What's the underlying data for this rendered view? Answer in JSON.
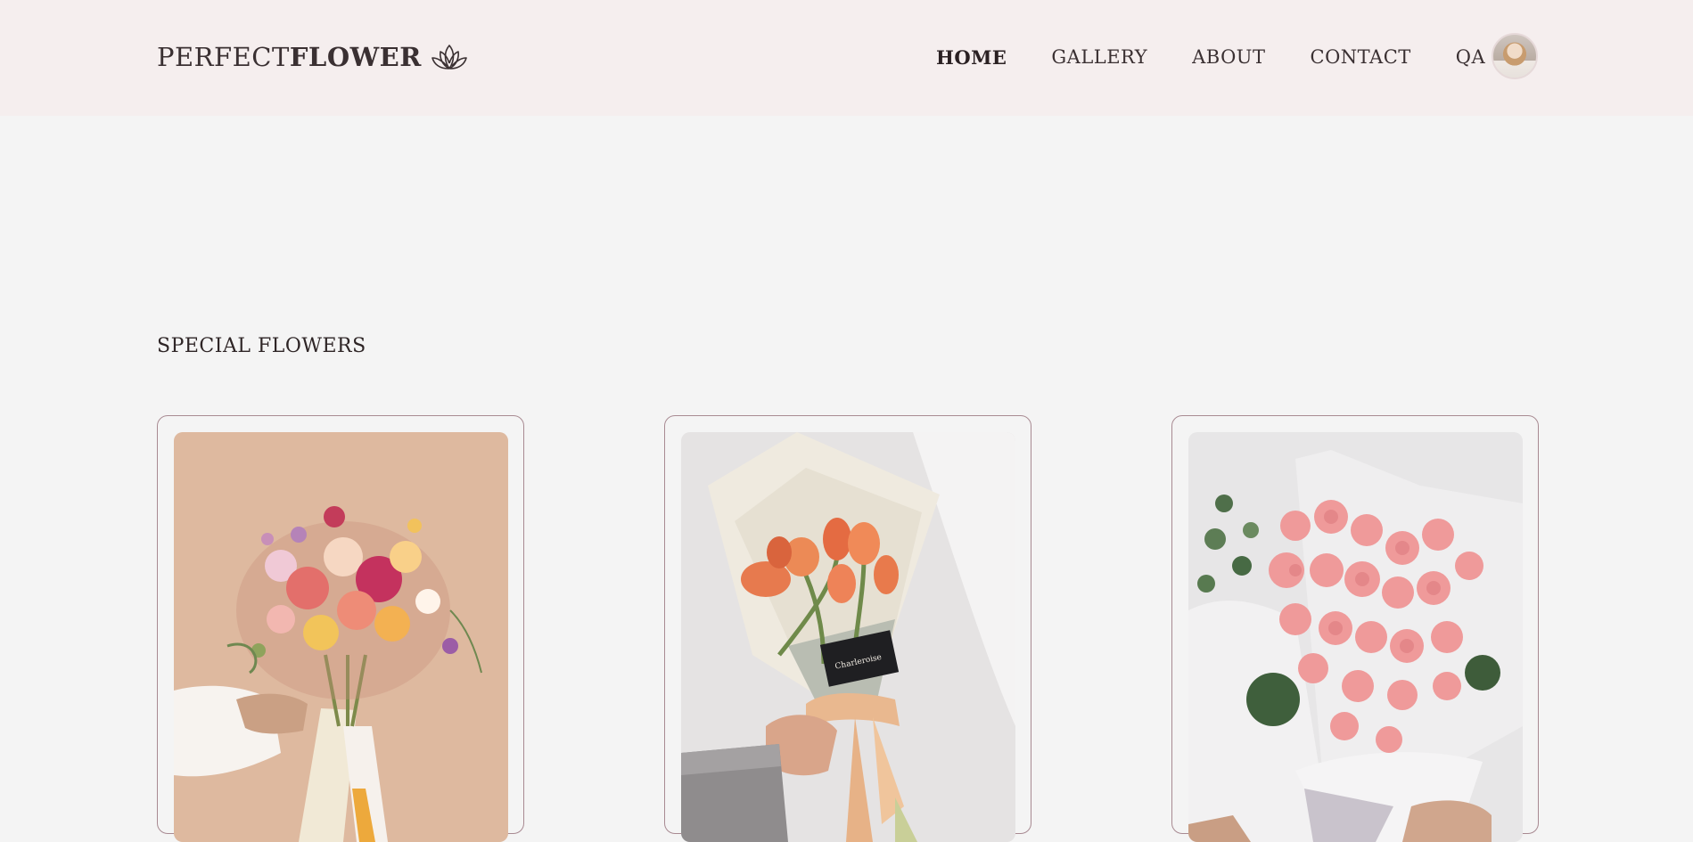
{
  "header": {
    "logo": {
      "light": "PERFECT",
      "bold": "FLOWER",
      "icon": "lotus-icon"
    },
    "nav": [
      {
        "label": "HOME",
        "active": true
      },
      {
        "label": "GALLERY",
        "active": false
      },
      {
        "label": "ABOUT",
        "active": false
      },
      {
        "label": "CONTACT",
        "active": false
      },
      {
        "label": "QA",
        "active": false
      }
    ],
    "avatar": "user-avatar"
  },
  "section": {
    "title": "SPECIAL FLOWERS"
  },
  "cards": [
    {
      "image": "mixed-wildflower-bouquet"
    },
    {
      "image": "orange-tulip-bouquet",
      "card_text": "Charleroise"
    },
    {
      "image": "pink-rose-bouquet"
    }
  ],
  "colors": {
    "header_bg": "#f5eeee",
    "page_bg": "#f4f4f4",
    "card_border": "#a88a92",
    "text": "#2e2526"
  }
}
